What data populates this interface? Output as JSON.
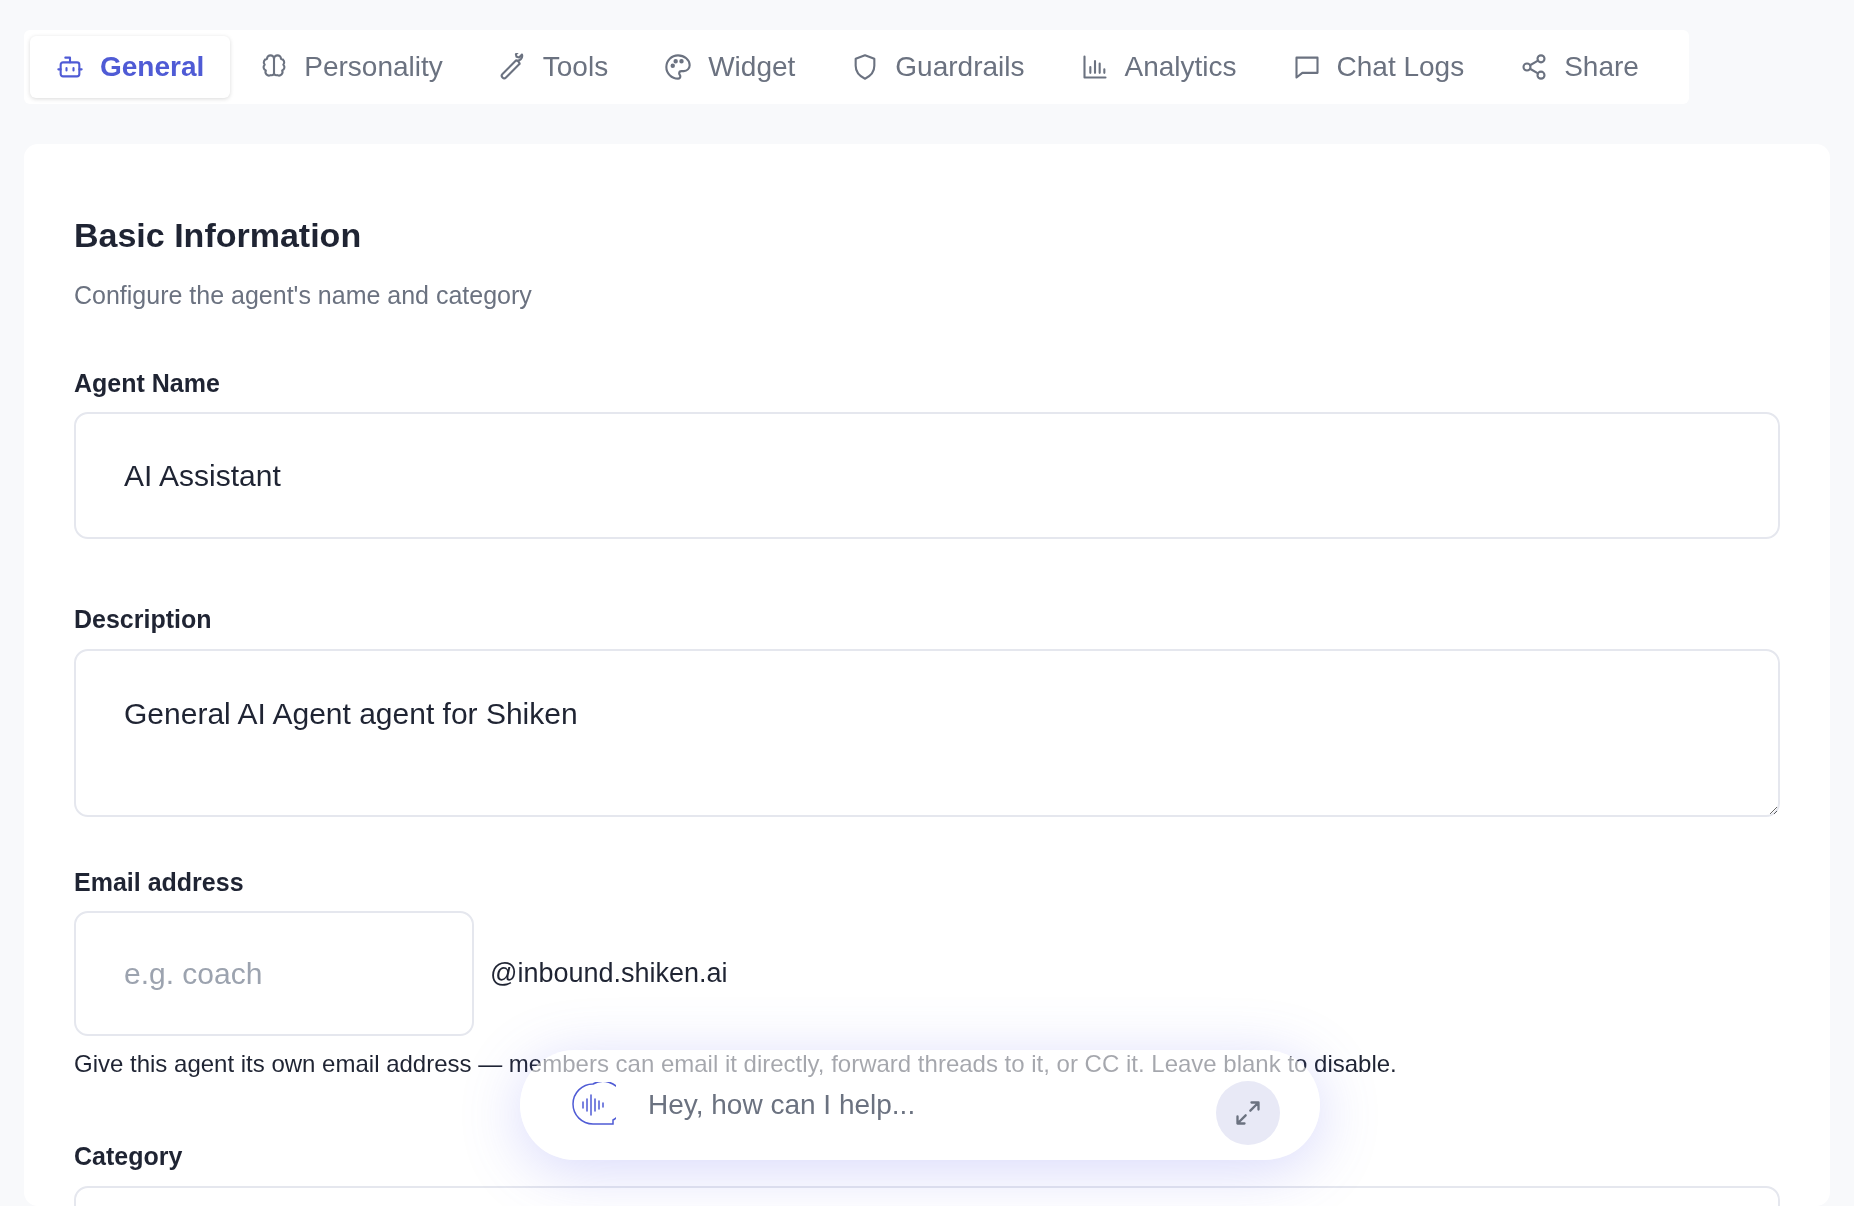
{
  "tabs": [
    {
      "label": "General",
      "selected": true
    },
    {
      "label": "Personality",
      "selected": false
    },
    {
      "label": "Tools",
      "selected": false
    },
    {
      "label": "Widget",
      "selected": false
    },
    {
      "label": "Guardrails",
      "selected": false
    },
    {
      "label": "Analytics",
      "selected": false
    },
    {
      "label": "Chat Logs",
      "selected": false
    },
    {
      "label": "Share",
      "selected": false
    }
  ],
  "section": {
    "title": "Basic Information",
    "subtitle": "Configure the agent's name and category"
  },
  "agent_name": {
    "label": "Agent Name",
    "value": "AI Assistant"
  },
  "description": {
    "label": "Description",
    "value": "General AI Agent agent for Shiken"
  },
  "email": {
    "label": "Email address",
    "placeholder": "e.g. coach",
    "suffix": "@inbound.shiken.ai",
    "hint": "Give this agent its own email address — members can email it directly, forward threads to it, or CC it. Leave blank to disable."
  },
  "category": {
    "label": "Category"
  },
  "chat_bar": {
    "placeholder": "Hey, how can I help..."
  }
}
